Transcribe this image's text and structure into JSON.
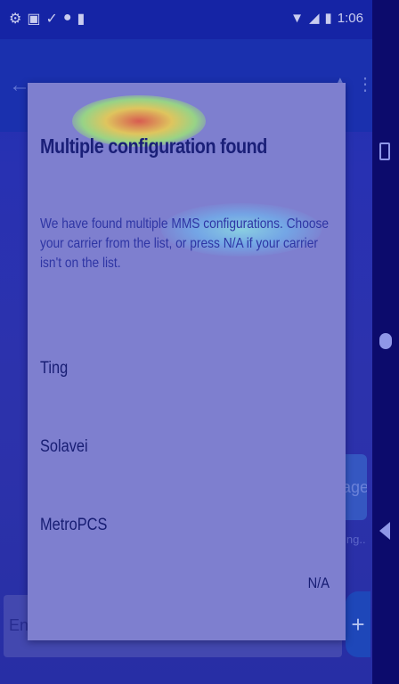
{
  "status_bar": {
    "time": "1:06",
    "left_icons": [
      "gear-icon",
      "sim-icon",
      "check-icon",
      "circle-icon",
      "sd-card-icon"
    ],
    "right_icons": [
      "wifi-icon",
      "signal-icon",
      "battery-icon"
    ]
  },
  "app_bar": {
    "icons": [
      "back-arrow-icon",
      "overflow-menu-icon"
    ]
  },
  "background": {
    "input_placeholder": "Ente",
    "send_icon": "+",
    "side_button_fragment": "age",
    "side_note_fragment": "ing.."
  },
  "dialog": {
    "title": "Multiple configuration found",
    "message": "We have found multiple MMS configurations. Choose your carrier from the list, or press N/A if your carrier isn't on the list.",
    "options": [
      {
        "label": "Ting"
      },
      {
        "label": "Solavei"
      },
      {
        "label": "MetroPCS"
      }
    ],
    "na_button": "N/A"
  },
  "nav_bar": {
    "icons": [
      "recents-icon",
      "home-icon",
      "back-icon"
    ]
  }
}
